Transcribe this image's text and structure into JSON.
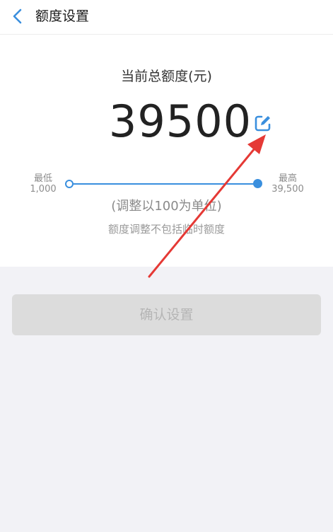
{
  "header": {
    "title": "额度设置",
    "back_icon": "chevron-left-icon"
  },
  "limit": {
    "current_label": "当前总额度(元)",
    "amount": "39500",
    "edit_icon": "edit-icon"
  },
  "slider": {
    "min_label": "最低",
    "min_value": "1,000",
    "max_label": "最高",
    "max_value": "39,500",
    "level": 1.0
  },
  "hints": {
    "unit_note": "(调整以100为单位)",
    "temp_note": "额度调整不包括临时额度"
  },
  "confirm_button": {
    "label": "确认设置"
  },
  "colors": {
    "accent": "#3a8fde",
    "annotation_arrow": "#e53935"
  }
}
